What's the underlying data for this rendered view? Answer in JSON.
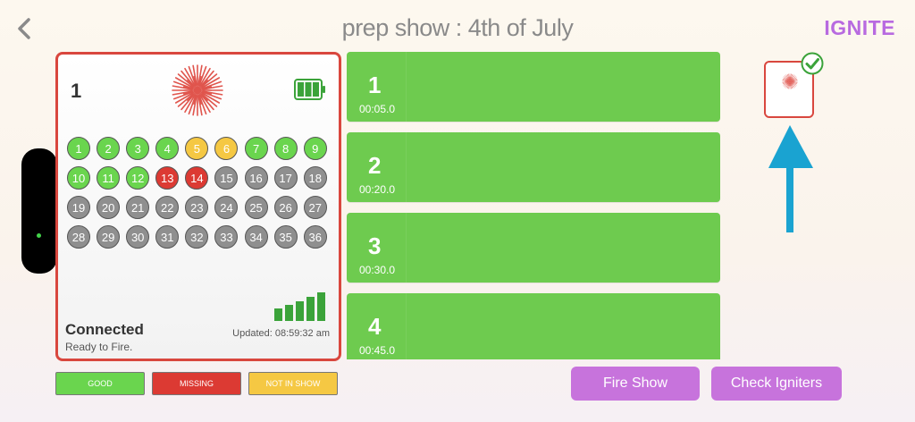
{
  "header": {
    "title": "prep show :  4th of July",
    "logo": "IGNITE"
  },
  "module": {
    "number": "1",
    "status": "Connected",
    "substatus": "Ready to Fire.",
    "updated": "Updated: 08:59:32 am",
    "battery_level": 1.0,
    "signal_bars": 5,
    "cues": [
      {
        "label": "1",
        "state": "good"
      },
      {
        "label": "2",
        "state": "good"
      },
      {
        "label": "3",
        "state": "good"
      },
      {
        "label": "4",
        "state": "good"
      },
      {
        "label": "5",
        "state": "notinshow"
      },
      {
        "label": "6",
        "state": "notinshow"
      },
      {
        "label": "7",
        "state": "good"
      },
      {
        "label": "8",
        "state": "good"
      },
      {
        "label": "9",
        "state": "good"
      },
      {
        "label": "10",
        "state": "good"
      },
      {
        "label": "11",
        "state": "good"
      },
      {
        "label": "12",
        "state": "good"
      },
      {
        "label": "13",
        "state": "missing"
      },
      {
        "label": "14",
        "state": "missing"
      },
      {
        "label": "15",
        "state": "idle"
      },
      {
        "label": "16",
        "state": "idle"
      },
      {
        "label": "17",
        "state": "idle"
      },
      {
        "label": "18",
        "state": "idle"
      },
      {
        "label": "19",
        "state": "idle"
      },
      {
        "label": "20",
        "state": "idle"
      },
      {
        "label": "21",
        "state": "idle"
      },
      {
        "label": "22",
        "state": "idle"
      },
      {
        "label": "23",
        "state": "idle"
      },
      {
        "label": "24",
        "state": "idle"
      },
      {
        "label": "25",
        "state": "idle"
      },
      {
        "label": "26",
        "state": "idle"
      },
      {
        "label": "27",
        "state": "idle"
      },
      {
        "label": "28",
        "state": "idle"
      },
      {
        "label": "29",
        "state": "idle"
      },
      {
        "label": "30",
        "state": "idle"
      },
      {
        "label": "31",
        "state": "idle"
      },
      {
        "label": "32",
        "state": "idle"
      },
      {
        "label": "33",
        "state": "idle"
      },
      {
        "label": "34",
        "state": "idle"
      },
      {
        "label": "35",
        "state": "idle"
      },
      {
        "label": "36",
        "state": "idle"
      }
    ]
  },
  "legend": {
    "good": "GOOD",
    "missing": "MISSING",
    "not_in_show": "NOT IN SHOW"
  },
  "show_cues": [
    {
      "number": "1",
      "time": "00:05.0"
    },
    {
      "number": "2",
      "time": "00:20.0"
    },
    {
      "number": "3",
      "time": "00:30.0"
    },
    {
      "number": "4",
      "time": "00:45.0"
    }
  ],
  "buttons": {
    "fire_show": "Fire Show",
    "check_igniters": "Check Igniters"
  },
  "colors": {
    "good": "#6ad54e",
    "missing": "#dc3a33",
    "not_in_show": "#f5c843",
    "idle": "#8f8f8f",
    "accent": "#c773dc",
    "cue_row": "#6ecb4f",
    "arrow": "#1aa3d1"
  },
  "icons": {
    "back": "chevron-left-icon",
    "firework": "firework-icon",
    "battery": "battery-icon",
    "signal": "signal-strength-icon",
    "check": "checkmark-icon",
    "arrow": "arrow-up-icon"
  }
}
